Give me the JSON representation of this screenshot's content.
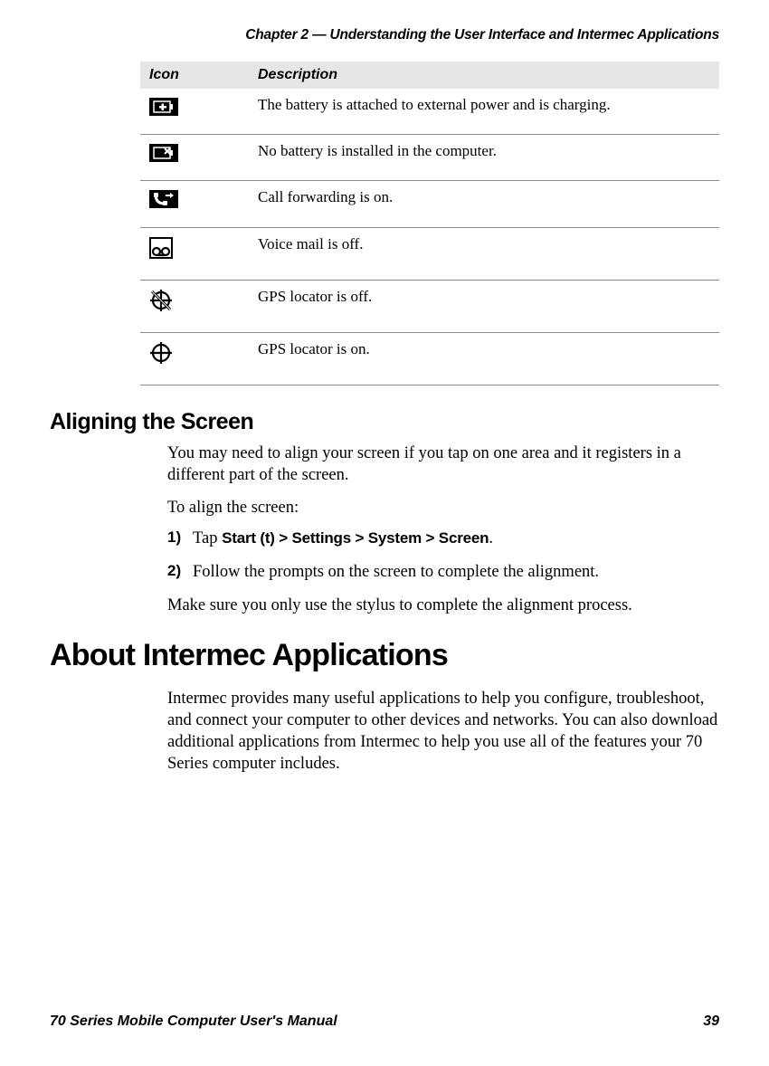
{
  "runningHead": "Chapter 2 — Understanding the User Interface and Intermec Applications",
  "table": {
    "headers": {
      "icon": "Icon",
      "desc": "Description"
    },
    "rows": [
      {
        "iconName": "battery-charging-icon",
        "desc": "The battery is attached to external power and is charging."
      },
      {
        "iconName": "no-battery-icon",
        "desc": "No battery is installed in the computer."
      },
      {
        "iconName": "call-forwarding-icon",
        "desc": "Call forwarding is on."
      },
      {
        "iconName": "voicemail-off-icon",
        "desc": "Voice mail is off."
      },
      {
        "iconName": "gps-off-icon",
        "desc": "GPS locator is off."
      },
      {
        "iconName": "gps-on-icon",
        "desc": "GPS locator is on."
      }
    ]
  },
  "section1": {
    "heading": "Aligning the Screen",
    "p1": "You may need to align your screen if you tap on one area and it registers in a different part of the screen.",
    "p2": "To align the screen:",
    "steps": [
      {
        "n": "1)",
        "pre": "Tap ",
        "bold": "Start (t) > Settings > System > Screen",
        "post": "."
      },
      {
        "n": "2)",
        "pre": "Follow the prompts on the screen to complete the alignment.",
        "bold": "",
        "post": ""
      }
    ],
    "p3": "Make sure you only use the stylus to complete the alignment process."
  },
  "section2": {
    "heading": "About Intermec Applications",
    "p1": "Intermec provides many useful applications to help you configure, troubleshoot, and connect your computer to other devices and networks. You can also download additional applications from Intermec to help you use all of the features your 70 Series computer includes."
  },
  "footer": {
    "left": "70 Series Mobile Computer User's Manual",
    "right": "39"
  }
}
